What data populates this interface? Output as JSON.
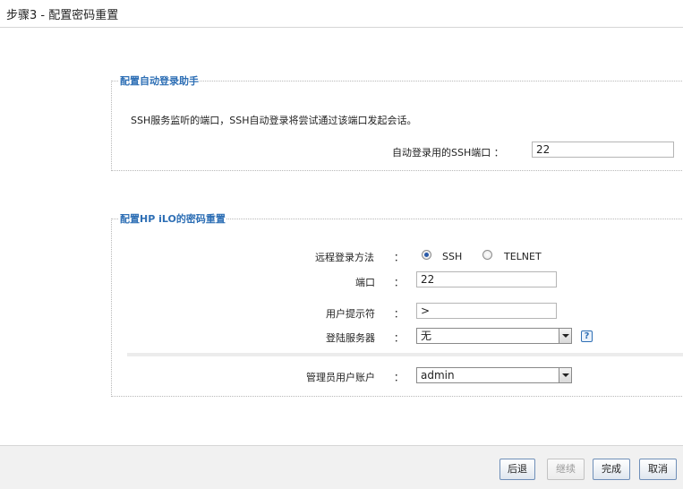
{
  "window": {
    "title": "步骤3 - 配置密码重置"
  },
  "auto_login": {
    "legend": "配置自动登录助手",
    "description": "SSH服务监听的端口，SSH自动登录将尝试通过该端口发起会话。",
    "ssh_port_label": "自动登录用的SSH端口 ：",
    "ssh_port_value": "22"
  },
  "hp_ilo": {
    "legend": "配置HP iLO的密码重置",
    "remote_login_label": "远程登录方法",
    "remote_login_options": [
      "SSH",
      "TELNET"
    ],
    "remote_login_selected": "SSH",
    "port_label": "端口",
    "port_value": "22",
    "prompt_label": "用户提示符",
    "prompt_value": ">",
    "login_server_label": "登陆服务器",
    "login_server_value": "无",
    "help_glyph": "?",
    "admin_account_label": "管理员用户账户",
    "admin_account_value": "admin",
    "colon": "："
  },
  "footer": {
    "back_label": "后退",
    "continue_label": "继续",
    "finish_label": "完成",
    "cancel_label": "取消"
  }
}
